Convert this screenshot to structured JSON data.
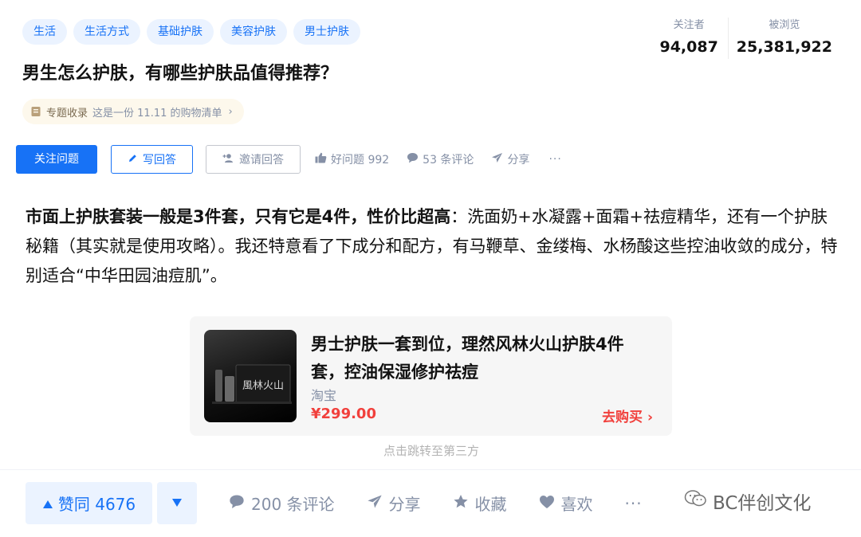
{
  "tags": [
    "生活",
    "生活方式",
    "基础护肤",
    "美容护肤",
    "男士护肤"
  ],
  "stats": {
    "followers_label": "关注者",
    "followers_value": "94,087",
    "views_label": "被浏览",
    "views_value": "25,381,922"
  },
  "question_title": "男生怎么护肤，有哪些护肤品值得推荐？",
  "topic": {
    "label": "专题收录",
    "text": "这是一份 11.11 的购物清单"
  },
  "actions": {
    "follow": "关注问题",
    "answer": "写回答",
    "invite": "邀请回答",
    "good_question": "好问题 992",
    "comments": "53 条评论",
    "share": "分享",
    "more": "···"
  },
  "answer": {
    "bold": "市面上护肤套装一般是3件套，只有它是4件，性价比超高",
    "rest": "：洗面奶+水凝露+面霜+祛痘精华，还有一个护肤秘籍（其实就是使用攻略）。我还特意看了下成分和配方，有马鞭草、金缕梅、水杨酸这些控油收敛的成分，特别适合“中华田园油痘肌”。"
  },
  "product_card": {
    "title": "男士护肤一套到位，理然风林火山护肤4件套，控油保湿修护祛痘",
    "source": "淘宝",
    "price": "¥299.00",
    "buy": "去购买",
    "image_text": "風林火山",
    "hint": "点击跳转至第三方"
  },
  "bottom_bar": {
    "upvote": "赞同 4676",
    "comments": "200 条评论",
    "share": "分享",
    "favorite": "收藏",
    "like": "喜欢",
    "more": "···"
  },
  "watermark": "BC伴创文化",
  "colors": {
    "accent": "#1772f6",
    "price": "#f1403c",
    "muted": "#8590a6"
  }
}
